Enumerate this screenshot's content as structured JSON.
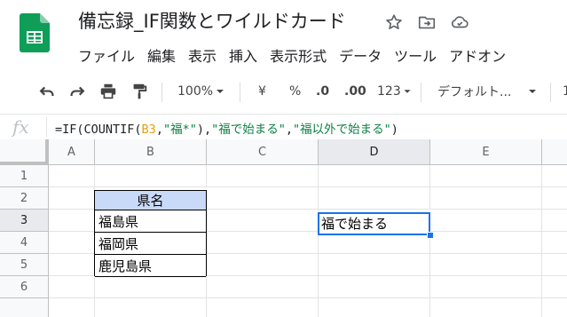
{
  "title": {
    "doc_name": "備忘録_IF関数とワイルドカード",
    "icons": [
      "star-icon",
      "move-folder-icon",
      "cloud-status-icon"
    ]
  },
  "menu": [
    "ファイル",
    "編集",
    "表示",
    "挿入",
    "表示形式",
    "データ",
    "ツール",
    "アドオン"
  ],
  "toolbar": {
    "zoom": "100%",
    "currency": "¥",
    "percent": "%",
    "decrease_decimals": ".0",
    "increase_decimals": ".00",
    "more_formats": "123",
    "font": "デフォルト...",
    "font_size_partial": "1"
  },
  "formula_bar": {
    "fx_label": "fx",
    "formula_parts": [
      {
        "t": "=IF(COUNTIF(",
        "k": "op"
      },
      {
        "t": "B3",
        "k": "ref"
      },
      {
        "t": ",",
        "k": "op"
      },
      {
        "t": "\"福*\"",
        "k": "str"
      },
      {
        "t": "),",
        "k": "op"
      },
      {
        "t": "\"福で始まる\"",
        "k": "str"
      },
      {
        "t": ",",
        "k": "op"
      },
      {
        "t": "\"福以外で始まる\"",
        "k": "str"
      },
      {
        "t": ")",
        "k": "op"
      }
    ]
  },
  "sheet": {
    "columns": [
      "A",
      "B",
      "C",
      "D",
      "E"
    ],
    "rows": [
      "1",
      "2",
      "3",
      "4",
      "5",
      "6"
    ],
    "active_column": "D",
    "active_row": "3",
    "cells": {
      "B2": "県名",
      "B3": "福島県",
      "B4": "福岡県",
      "B5": "鹿児島県",
      "D3": "福で始まる"
    },
    "colors": {
      "header_fill": "#c9daf8",
      "selection": "#1a73e8",
      "reference": "#e3a00f",
      "string": "#0b8043"
    }
  }
}
